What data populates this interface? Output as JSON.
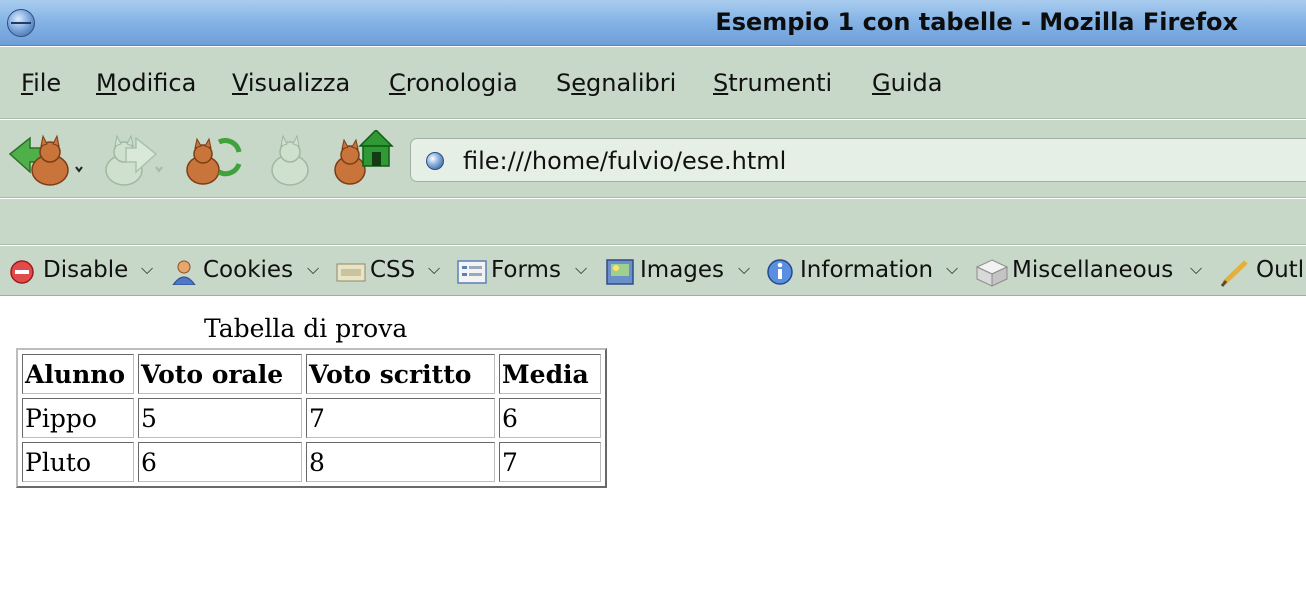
{
  "window": {
    "title": "Esempio 1 con tabelle - Mozilla Firefox"
  },
  "menubar": {
    "items": [
      {
        "pre": "",
        "key": "F",
        "post": "ile"
      },
      {
        "pre": "",
        "key": "M",
        "post": "odifica"
      },
      {
        "pre": "",
        "key": "V",
        "post": "isualizza"
      },
      {
        "pre": "",
        "key": "C",
        "post": "ronologia"
      },
      {
        "pre": "S",
        "key": "e",
        "post": "gnalibri"
      },
      {
        "pre": "",
        "key": "S",
        "post": "trumenti"
      },
      {
        "pre": "",
        "key": "G",
        "post": "uida"
      }
    ]
  },
  "navbar": {
    "icons": [
      "back-icon",
      "forward-icon",
      "reload-icon",
      "stop-icon",
      "home-icon"
    ],
    "url": "file:///home/fulvio/ese.html"
  },
  "devbar": {
    "items": [
      {
        "label": "Disable",
        "icon": "disable-icon"
      },
      {
        "label": "Cookies",
        "icon": "cookies-icon"
      },
      {
        "label": "CSS",
        "icon": "css-icon"
      },
      {
        "label": "Forms",
        "icon": "forms-icon"
      },
      {
        "label": "Images",
        "icon": "images-icon"
      },
      {
        "label": "Information",
        "icon": "information-icon"
      },
      {
        "label": "Miscellaneous",
        "icon": "miscellaneous-icon"
      },
      {
        "label": "Outl",
        "icon": "outline-icon"
      }
    ]
  },
  "page": {
    "caption": "Tabella di prova",
    "table": {
      "headers": [
        "Alunno",
        "Voto orale",
        "Voto scritto",
        "Media"
      ],
      "rows": [
        [
          "Pippo",
          "5",
          "7",
          "6"
        ],
        [
          "Pluto",
          "6",
          "8",
          "7"
        ]
      ]
    }
  },
  "colors": {
    "titlebar": "#86b4e6",
    "toolbar": "#c7d7c8",
    "cat": "#c8743a"
  }
}
